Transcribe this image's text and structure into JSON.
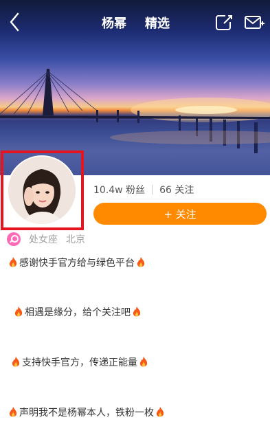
{
  "header": {
    "tabs": [
      {
        "label": "杨幂"
      },
      {
        "label": "精选"
      }
    ]
  },
  "profile": {
    "fans": "10.4w 粉丝",
    "following": "66 关注",
    "follow_button": "+ 关注",
    "zodiac": "处女座",
    "city": "北京"
  },
  "bio": [
    "感谢快手官方给与绿色平台",
    "相遇是缘分，给个关注吧",
    "支持快手官方，传递正能量",
    "声明我不是杨幂本人，铁粉一枚"
  ],
  "colors": {
    "accent": "#ff8a00",
    "highlight": "#e4151f",
    "zodiac": "#ff6ab7"
  }
}
